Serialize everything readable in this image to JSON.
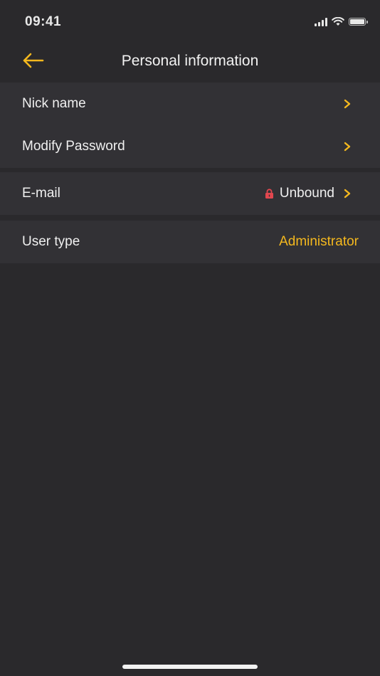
{
  "status_bar": {
    "time": "09:41"
  },
  "header": {
    "title": "Personal information",
    "back_icon": "arrow-left-icon"
  },
  "colors": {
    "accent": "#f4b81e",
    "lock": "#e2474f",
    "background": "#2a292c",
    "row_background": "#323135"
  },
  "groups": [
    {
      "rows": [
        {
          "label": "Nick name"
        },
        {
          "label": "Modify Password"
        }
      ]
    },
    {
      "rows": [
        {
          "label": "E-mail",
          "value": "Unbound",
          "value_icon": "lock-icon"
        }
      ]
    },
    {
      "rows": [
        {
          "label": "User type",
          "value": "Administrator"
        }
      ]
    }
  ]
}
